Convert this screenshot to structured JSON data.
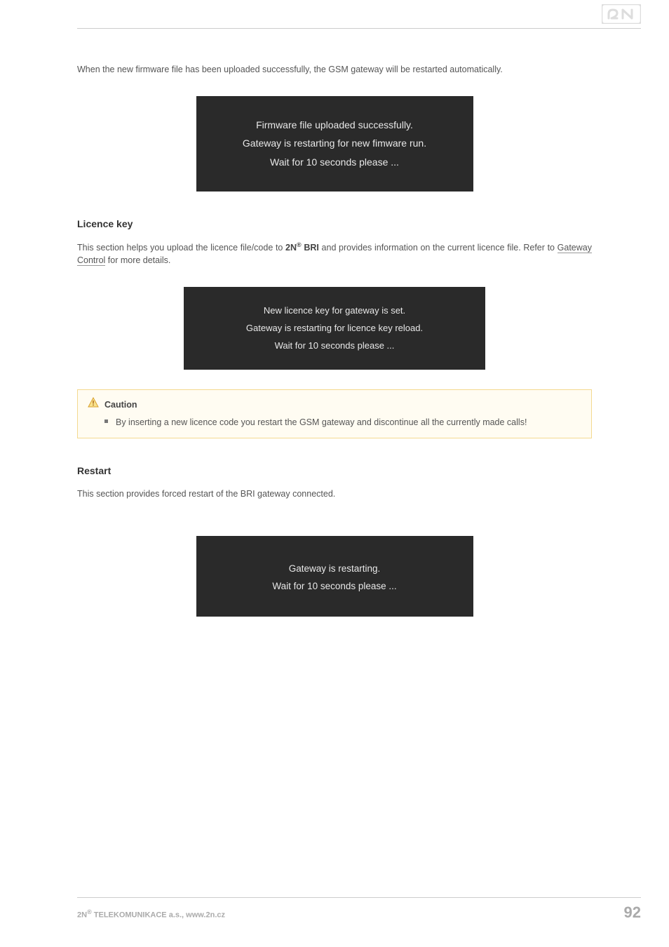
{
  "body1": "When the new firmware file has been uploaded successfully, the GSM gateway will be restarted automatically.",
  "box1": {
    "line1": "Firmware file uploaded successfully.",
    "line2": "Gateway is restarting for new fimware run.",
    "line3": "Wait for 10 seconds please ..."
  },
  "heading1": "Licence key",
  "body2a": "This section helps you upload the licence file/code to ",
  "body2b_bold": "2N",
  "body2b_sup": "®",
  "body2b_bold2": " BRI",
  "body2c": " and provides information on the current licence file. Refer to ",
  "body2_link": "Gateway Control",
  "body2d": " for more details.",
  "box2": {
    "line1": "New licence key for gateway is set.",
    "line2": "Gateway is restarting for licence key reload.",
    "line3": "Wait for 10 seconds please ..."
  },
  "caution": {
    "title": "Caution",
    "body": "By inserting a new licence code you restart the GSM gateway and discontinue all the currently made calls!"
  },
  "heading2": "Restart",
  "body3": "This section provides forced restart of the BRI gateway connected.",
  "box3": {
    "line1": "Gateway is restarting.",
    "line2": "Wait for 10 seconds please ..."
  },
  "footer": {
    "left_a": "2N",
    "left_sup": "®",
    "left_b": " TELEKOMUNIKACE a.s., www.2n.cz",
    "page": "92"
  }
}
